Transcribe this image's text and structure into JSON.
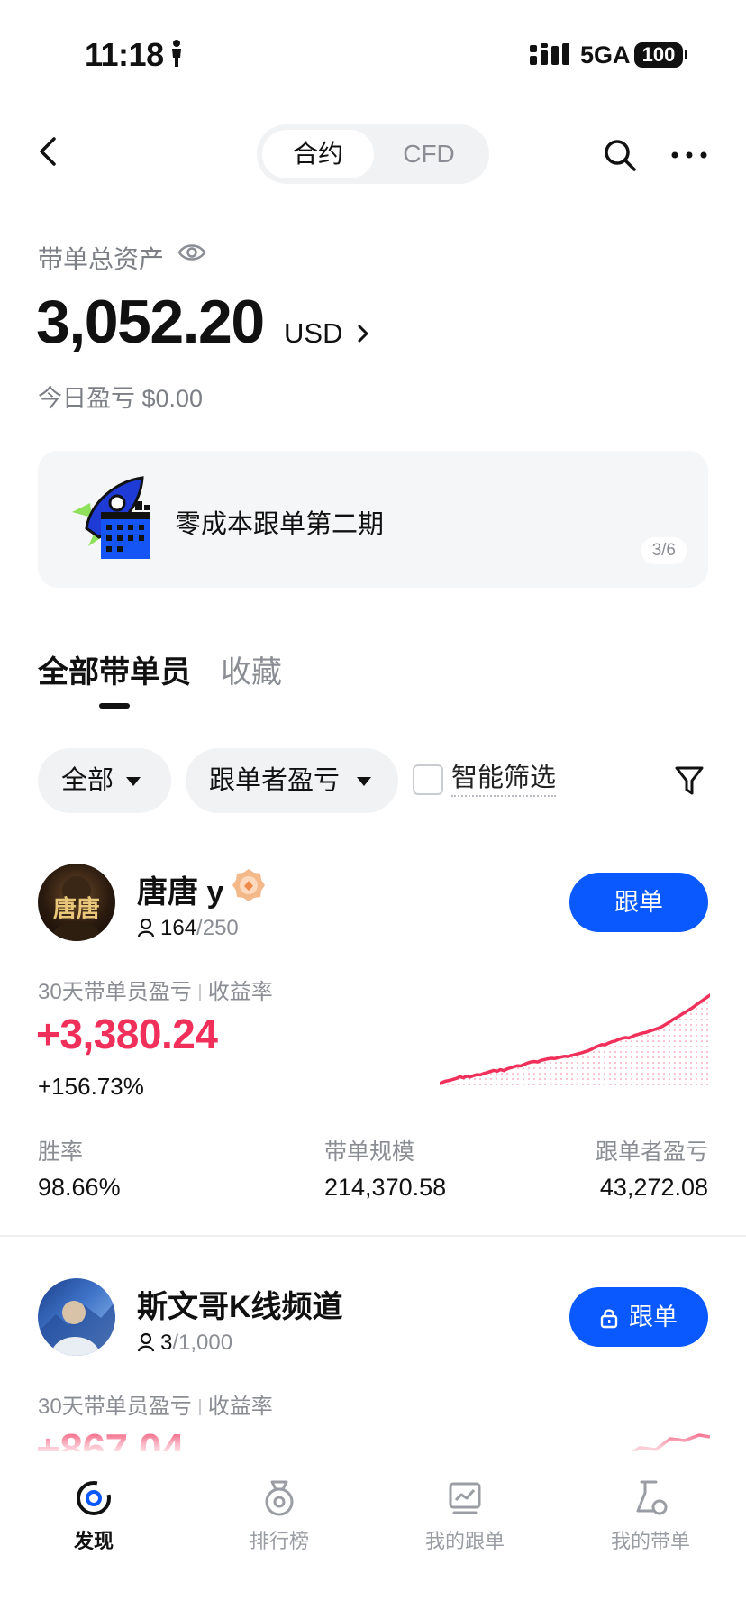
{
  "status_bar": {
    "time": "11:18",
    "network": "5GA",
    "battery": "100"
  },
  "header": {
    "segments": [
      "合约",
      "CFD"
    ],
    "active_segment": "合约"
  },
  "assets": {
    "label": "带单总资产",
    "value": "3,052.20",
    "unit": "USD",
    "today_pnl": "今日盈亏 $0.00"
  },
  "banner": {
    "text": "零成本跟单第二期",
    "page": "3/6"
  },
  "tabs": {
    "all": "全部带单员",
    "favorites": "收藏"
  },
  "filters": {
    "all": "全部",
    "sort": "跟单者盈亏",
    "smart": "智能筛选"
  },
  "traders": [
    {
      "name": "唐唐 y",
      "avatar_text": "唐唐",
      "followers": "164",
      "capacity": "/250",
      "button": "跟单",
      "locked": false,
      "pnl_label": "30天带单员盈亏",
      "rate_label": "收益率",
      "pnl": "+3,380.24",
      "rate": "+156.73%",
      "spark": [
        2,
        8,
        12,
        14,
        18,
        22,
        28,
        24,
        30,
        27,
        32,
        36,
        35,
        40,
        44,
        48,
        52,
        49,
        55,
        51,
        58,
        62,
        66,
        70,
        69,
        75,
        80,
        84,
        86,
        84,
        90,
        93,
        96,
        98,
        97,
        100,
        103,
        106,
        105,
        109,
        112,
        116,
        119,
        123,
        127,
        133,
        140,
        145,
        150,
        149,
        156,
        161,
        164,
        170,
        174,
        177,
        175,
        181,
        186,
        190,
        194,
        196,
        201,
        205,
        209,
        214,
        220,
        228,
        236,
        245,
        252,
        260,
        268,
        276,
        284,
        292,
        302,
        311,
        320,
        329,
        338
      ],
      "stats": [
        {
          "label": "胜率",
          "value": "98.66%"
        },
        {
          "label": "带单规模",
          "value": "214,370.58"
        },
        {
          "label": "跟单者盈亏",
          "value": "43,272.08"
        }
      ]
    },
    {
      "name": "斯文哥K线频道",
      "followers": "3",
      "capacity": "/1,000",
      "button": "跟单",
      "locked": true,
      "pnl_label": "30天带单员盈亏",
      "rate_label": "收益率",
      "pnl": "+867.04"
    }
  ],
  "bottom_nav": [
    {
      "label": "发现",
      "icon": "discover-icon",
      "active": true
    },
    {
      "label": "排行榜",
      "icon": "ranking-icon",
      "active": false
    },
    {
      "label": "我的跟单",
      "icon": "my-copy-icon",
      "active": false
    },
    {
      "label": "我的带单",
      "icon": "my-lead-icon",
      "active": false
    }
  ],
  "colors": {
    "accent": "#0a59ff",
    "profit": "#f0305a",
    "muted": "#8a8d93"
  }
}
